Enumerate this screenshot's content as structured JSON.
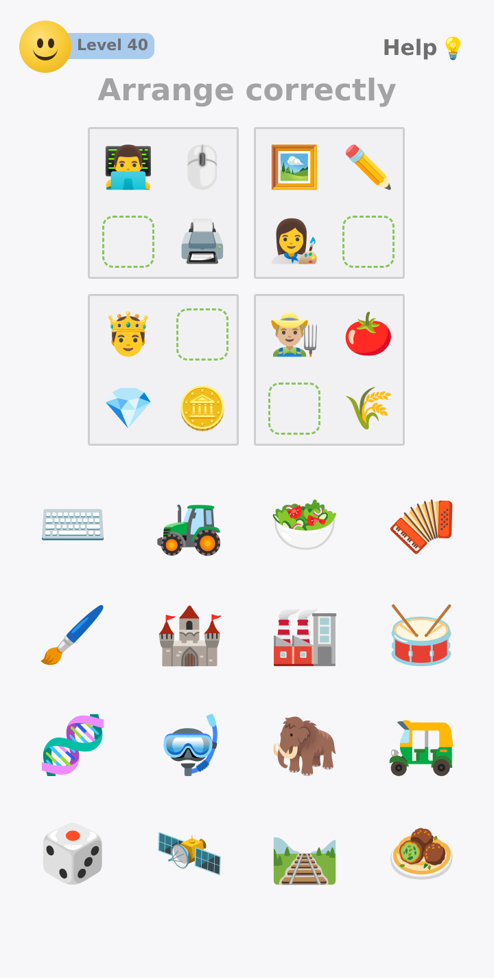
{
  "header": {
    "level_label": "Level 40",
    "help_label": "Help",
    "help_icon": "💡",
    "title": "Arrange correctly"
  },
  "panels": [
    {
      "cells": [
        "👨‍💻",
        "🖱️",
        "",
        "🖨️"
      ]
    },
    {
      "cells": [
        "🖼️",
        "✏️",
        "👩‍🎨",
        ""
      ]
    },
    {
      "cells": [
        "🤴",
        "",
        "💎",
        "🪙"
      ]
    },
    {
      "cells": [
        "👨🏼‍🌾",
        "🍅",
        "",
        "🌾"
      ]
    }
  ],
  "pool": [
    "⌨️",
    "🚜",
    "🥗",
    "🪗",
    "🖌️",
    "🏰",
    "🏭",
    "🥁",
    "🧬",
    "🤿",
    "🦣",
    "🛺",
    "🎲",
    "🛰️",
    "🛤️",
    "🧆"
  ],
  "colors": {
    "background": "#f7f7f9",
    "level_pill": "#a9ccee",
    "slot_border": "#89c55b",
    "panel_border": "#cfcfcf",
    "title": "#a3a3a3"
  }
}
